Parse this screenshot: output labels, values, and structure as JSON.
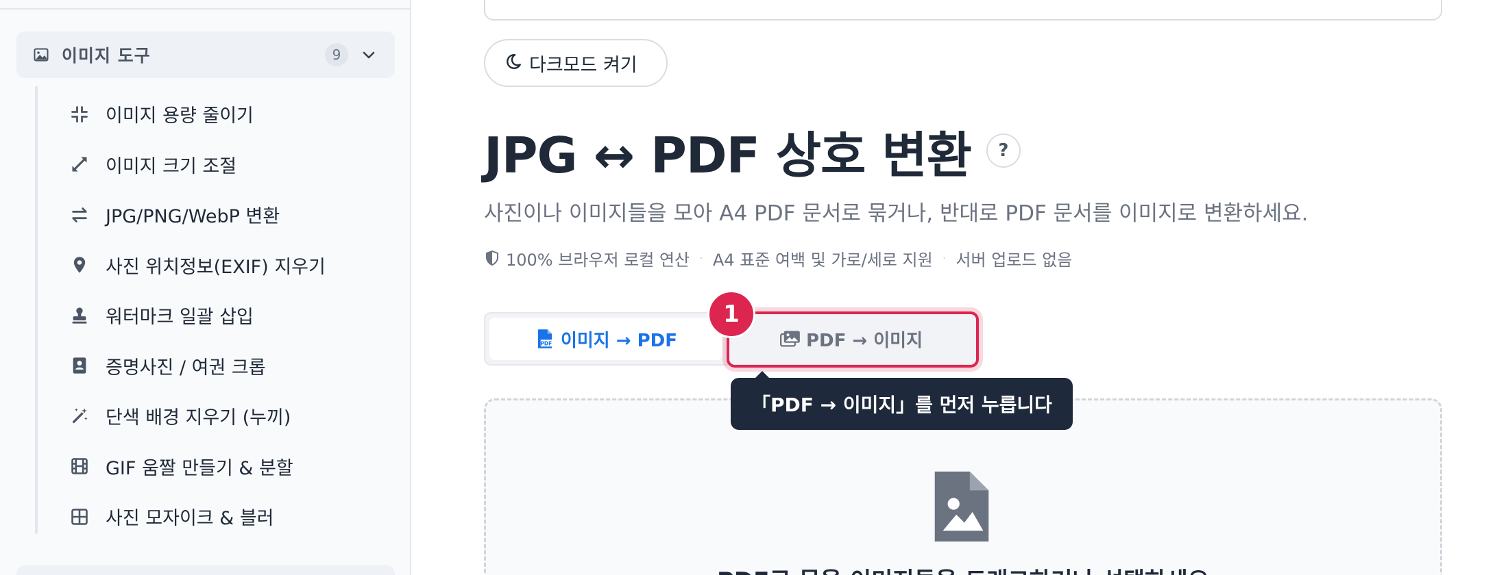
{
  "sidebar": {
    "group": {
      "label": "이미지 도구",
      "count": "9",
      "icon": "image-icon"
    },
    "items": [
      {
        "label": "이미지 용량 줄이기",
        "icon": "compress-icon"
      },
      {
        "label": "이미지 크기 조절",
        "icon": "expand-icon"
      },
      {
        "label": "JPG/PNG/WebP 변환",
        "icon": "swap-icon"
      },
      {
        "label": "사진 위치정보(EXIF) 지우기",
        "icon": "location-pin-icon"
      },
      {
        "label": "워터마크 일괄 삽입",
        "icon": "stamp-icon"
      },
      {
        "label": "증명사진 / 여권 크롭",
        "icon": "id-badge-icon"
      },
      {
        "label": "단색 배경 지우기 (누끼)",
        "icon": "magic-wand-icon"
      },
      {
        "label": "GIF 움짤 만들기 & 분할",
        "icon": "film-icon"
      },
      {
        "label": "사진 모자이크 & 블러",
        "icon": "grid-icon"
      }
    ]
  },
  "main": {
    "dark_mode_label": "다크모드 켜기",
    "title": "JPG ↔ PDF 상호 변환",
    "help_label": "?",
    "subtitle": "사진이나 이미지들을 모아 A4 PDF 문서로 묶거나, 반대로 PDF 문서를 이미지로 변환하세요.",
    "features": [
      "100% 브라우저 로컬 연산",
      "A4 표준 여백 및 가로/세로 지원",
      "서버 업로드 없음"
    ],
    "tabs": [
      {
        "label": "이미지 → PDF",
        "icon": "pdf-file-icon",
        "active": true
      },
      {
        "label": "PDF → 이미지",
        "icon": "images-icon",
        "active": false
      }
    ],
    "dropzone_text": "PDF로 묶을 이미지들을 드래그하거나 선택하세요"
  },
  "guide": {
    "step": "1",
    "tooltip": "「PDF → 이미지」를 먼저 누릅니다",
    "accent_color": "#dc2650"
  },
  "colors": {
    "active_tab": "#1a73e8",
    "tooltip_bg": "#1e293b"
  }
}
